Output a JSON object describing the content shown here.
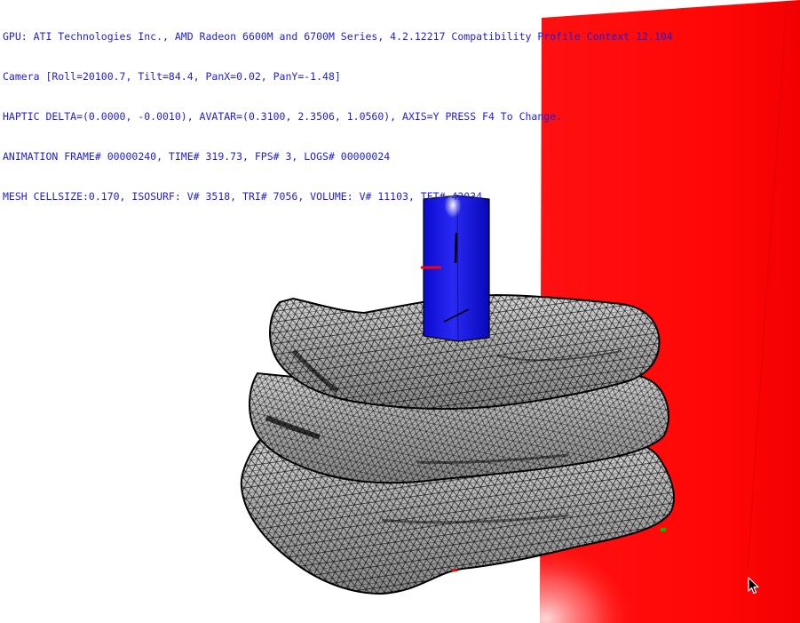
{
  "hud": {
    "lines": [
      "GPU: ATI Technologies Inc., AMD Radeon 6600M and 6700M Series, 4.2.12217 Compatibility Profile Context 12.104",
      "Camera [Roll=20100.7, Tilt=84.4, PanX=0.02, PanY=-1.48]",
      "HAPTIC DELTA=(0.0000, -0.0010), AVATAR=(0.3100, 2.3506, 1.0560), AXIS=Y PRESS F4 To Change.",
      "ANIMATION FRAME# 00000240, TIME# 319.73, FPS# 3, LOGS# 00000024",
      "MESH CELLSIZE:0.170, ISOSURF: V# 3518, TRI# 7056, VOLUME: V# 11103, TET# 43034"
    ]
  },
  "colors": {
    "hud_text": "#1d1de0",
    "background": "#ffffff",
    "wall": "#ff0a0a",
    "avatar": "#1414e6",
    "mesh_fill": "#b8b8b8",
    "mesh_wire": "#000000"
  },
  "icons": {
    "cursor": "mouse-pointer-icon"
  }
}
